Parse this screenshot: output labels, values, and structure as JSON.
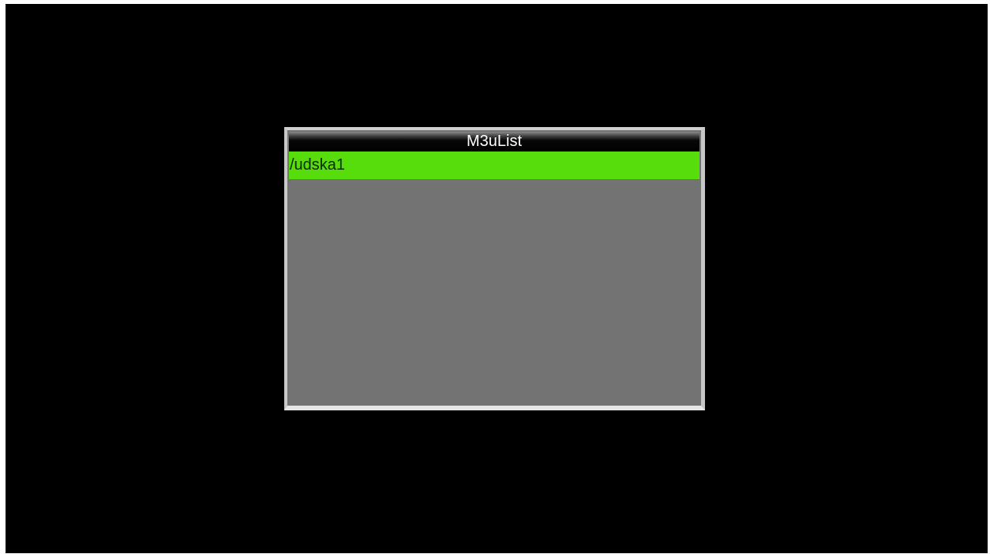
{
  "dialog": {
    "title": "M3uList",
    "items": [
      {
        "label": "/udska1",
        "selected": true
      }
    ]
  },
  "colors": {
    "screen_background": "#000000",
    "dialog_background": "#737373",
    "dialog_border": "#d0d0d0",
    "selection_highlight": "#56dd0b",
    "title_text": "#ffffff"
  }
}
